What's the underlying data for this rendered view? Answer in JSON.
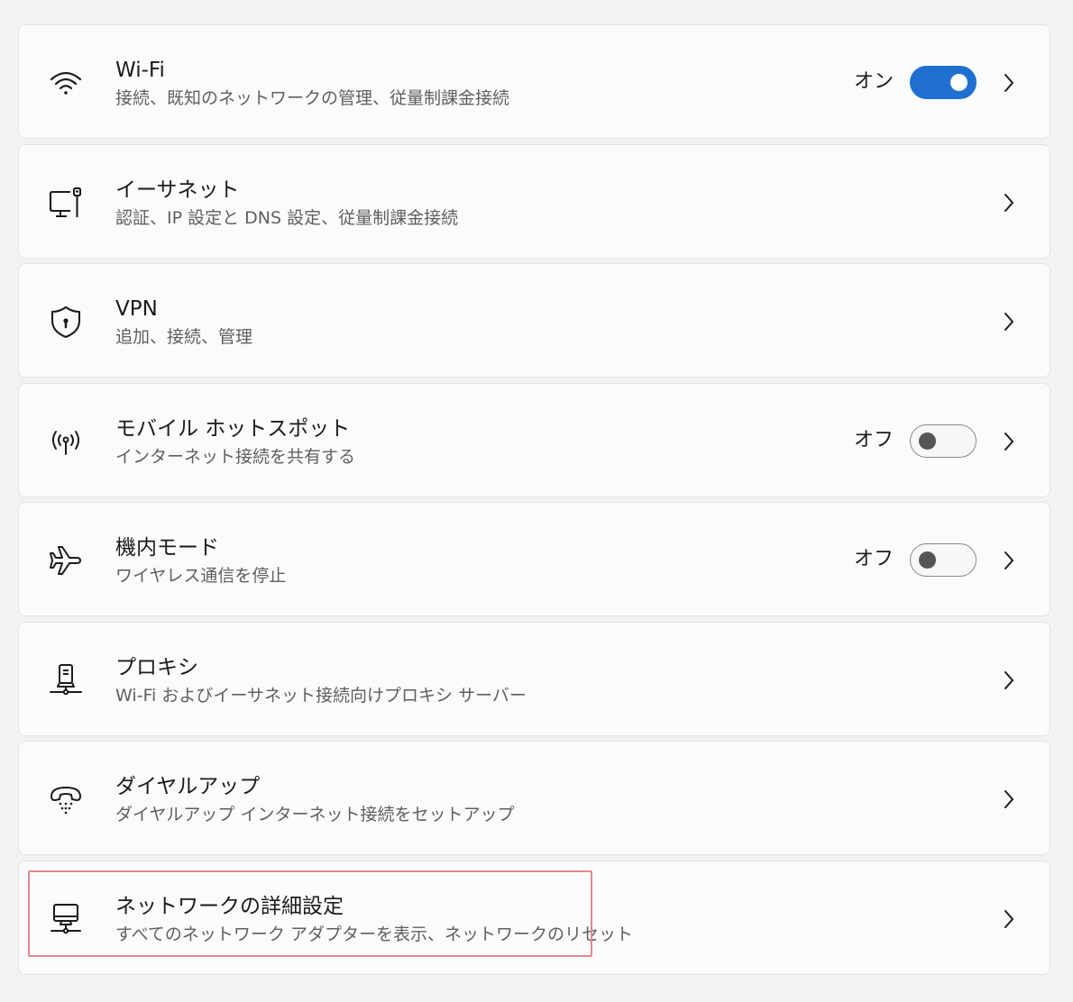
{
  "colors": {
    "accent": "#1f6fd1",
    "highlight_border": "#e08a8a"
  },
  "items": [
    {
      "title": "Wi-Fi",
      "subtitle": "接続、既知のネットワークの管理、従量制課金接続",
      "icon": "wifi-icon",
      "state_label": "オン",
      "toggle": "on"
    },
    {
      "title": "イーサネット",
      "subtitle": "認証、IP 設定と DNS 設定、従量制課金接続",
      "icon": "ethernet-icon"
    },
    {
      "title": "VPN",
      "subtitle": "追加、接続、管理",
      "icon": "shield-icon"
    },
    {
      "title": "モバイル ホットスポット",
      "subtitle": "インターネット接続を共有する",
      "icon": "hotspot-icon",
      "state_label": "オフ",
      "toggle": "off"
    },
    {
      "title": "機内モード",
      "subtitle": "ワイヤレス通信を停止",
      "icon": "airplane-icon",
      "state_label": "オフ",
      "toggle": "off"
    },
    {
      "title": "プロキシ",
      "subtitle": "Wi-Fi およびイーサネット接続向けプロキシ サーバー",
      "icon": "proxy-server-icon"
    },
    {
      "title": "ダイヤルアップ",
      "subtitle": "ダイヤルアップ インターネット接続をセットアップ",
      "icon": "dialup-phone-icon"
    },
    {
      "title": "ネットワークの詳細設定",
      "subtitle": "すべてのネットワーク アダプターを表示、ネットワークのリセット",
      "icon": "network-adapter-icon",
      "highlighted": true
    }
  ]
}
